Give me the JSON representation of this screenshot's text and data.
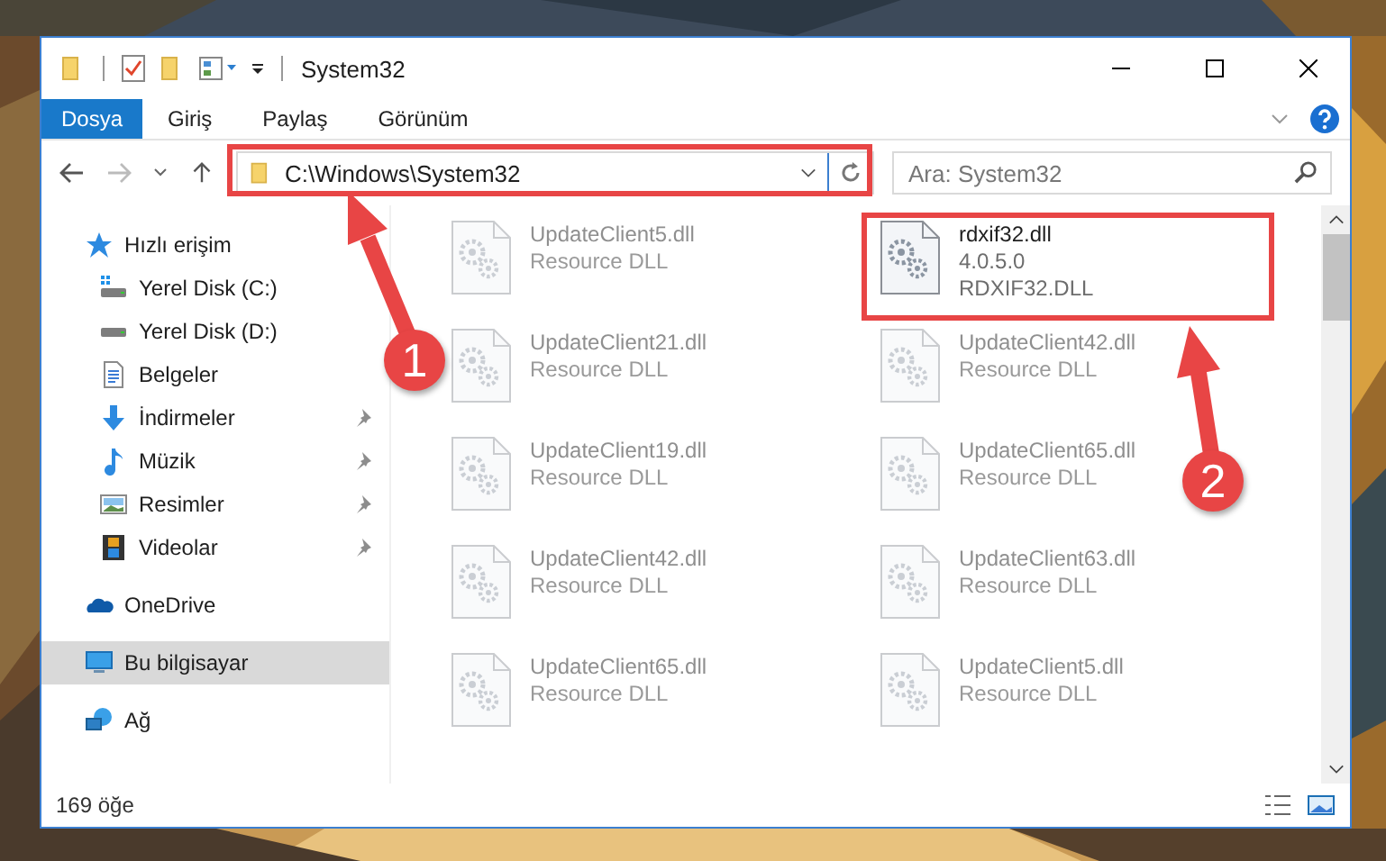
{
  "window": {
    "title": "System32"
  },
  "ribbon_tabs": [
    {
      "label": "Dosya",
      "selected": true
    },
    {
      "label": "Giriş",
      "selected": false
    },
    {
      "label": "Paylaş",
      "selected": false
    },
    {
      "label": "Görünüm",
      "selected": false
    }
  ],
  "address_bar": {
    "path": "C:\\Windows\\System32"
  },
  "search": {
    "placeholder": "Ara: System32"
  },
  "sidebar": {
    "items": [
      {
        "label": "Hızlı erişim",
        "kind": "star",
        "selected": false,
        "children": [
          {
            "label": "Yerel Disk (C:)",
            "kind": "system-drive",
            "pinned": false
          },
          {
            "label": "Yerel Disk (D:)",
            "kind": "drive",
            "pinned": false
          },
          {
            "label": "Belgeler",
            "kind": "documents",
            "pinned": false
          },
          {
            "label": "İndirmeler",
            "kind": "download",
            "pinned": true
          },
          {
            "label": "Müzik",
            "kind": "music",
            "pinned": true
          },
          {
            "label": "Resimler",
            "kind": "pictures",
            "pinned": true
          },
          {
            "label": "Videolar",
            "kind": "videos",
            "pinned": true
          }
        ]
      },
      {
        "label": "OneDrive",
        "kind": "cloud",
        "selected": false
      },
      {
        "label": "Bu bilgisayar",
        "kind": "computer",
        "selected": true
      },
      {
        "label": "Ağ",
        "kind": "network",
        "selected": false
      }
    ]
  },
  "files": [
    {
      "name": "UpdateClient5.dll",
      "lines": [
        "Resource DLL"
      ],
      "blurred": true
    },
    {
      "name": "rdxif32.dll",
      "lines": [
        "4.0.5.0",
        "RDXIF32.DLL"
      ],
      "blurred": false
    },
    {
      "name": "UpdateClient21.dll",
      "lines": [
        "Resource DLL"
      ],
      "blurred": true
    },
    {
      "name": "UpdateClient42.dll",
      "lines": [
        "Resource DLL"
      ],
      "blurred": true
    },
    {
      "name": "UpdateClient19.dll",
      "lines": [
        "Resource DLL"
      ],
      "blurred": true
    },
    {
      "name": "UpdateClient65.dll",
      "lines": [
        "Resource DLL"
      ],
      "blurred": true
    },
    {
      "name": "UpdateClient42.dll",
      "lines": [
        "Resource DLL"
      ],
      "blurred": true
    },
    {
      "name": "UpdateClient63.dll",
      "lines": [
        "Resource DLL"
      ],
      "blurred": true
    },
    {
      "name": "UpdateClient65.dll",
      "lines": [
        "Resource DLL"
      ],
      "blurred": true
    },
    {
      "name": "UpdateClient5.dll",
      "lines": [
        "Resource DLL"
      ],
      "blurred": true
    }
  ],
  "status_bar": {
    "item_count": "169 öğe"
  },
  "annotations": [
    {
      "label": "1"
    },
    {
      "label": "2"
    }
  ]
}
